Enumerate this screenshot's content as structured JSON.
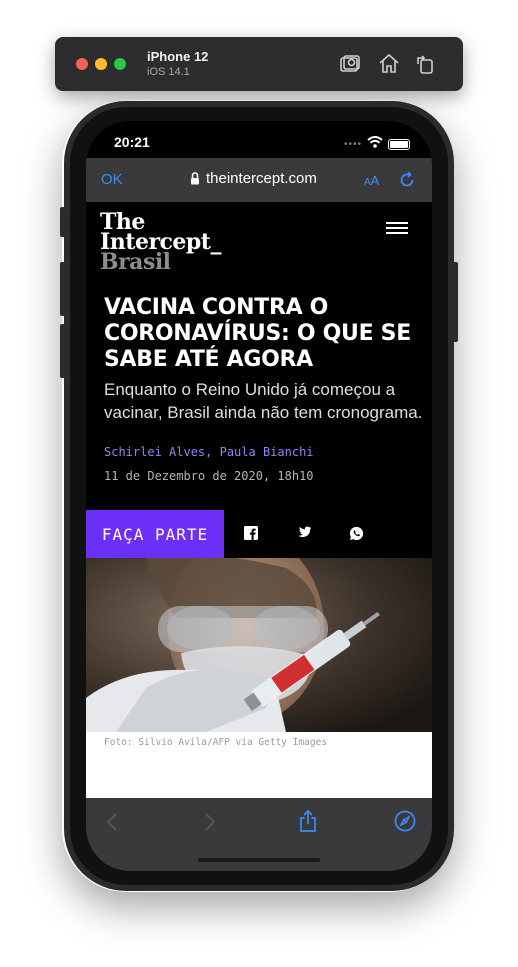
{
  "simulator": {
    "device_name": "iPhone 12",
    "os_version": "iOS 14.1",
    "icons": [
      "screenshot-icon",
      "home-icon",
      "rotate-icon"
    ]
  },
  "status_bar": {
    "time": "20:21"
  },
  "browser": {
    "done_label": "OK",
    "url": "theintercept.com",
    "text_size_label": "AA",
    "accent_color": "#3b8cf5"
  },
  "site": {
    "logo_line1": "The",
    "logo_line2": "Intercept_",
    "logo_line3": "Brasil"
  },
  "article": {
    "headline": "VACINA CONTRA O CORONAVÍRUS: O QUE SE SABE ATÉ AGORA",
    "subtitle": "Enquanto o Reino Unido já começou a vacinar, Brasil ainda não tem cronograma.",
    "authors": "Schirlei Alves, Paula Bianchi",
    "date": "11 de Dezembro de 2020, 18h10",
    "join_label": "FAÇA PARTE",
    "join_color": "#6b2ff5",
    "share_icons": [
      "facebook-icon",
      "twitter-icon",
      "whatsapp-icon"
    ],
    "photo_caption": "Foto: Silvio Avila/AFP via Getty Images"
  },
  "toolbar": {
    "icons": [
      "back-icon",
      "forward-icon",
      "share-icon",
      "compass-icon"
    ]
  }
}
